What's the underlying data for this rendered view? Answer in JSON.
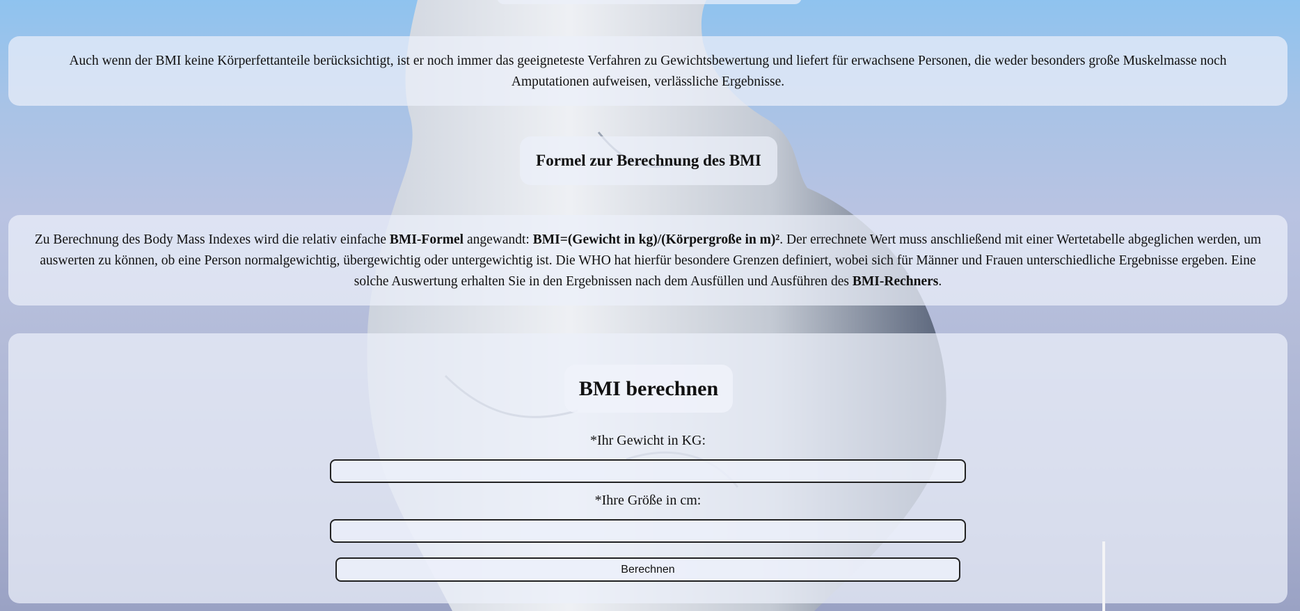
{
  "intro": {
    "text": "Auch wenn der BMI keine Körperfettanteile berücksichtigt, ist er noch immer das geeigneteste Verfahren zu Gewichtsbewertung und liefert für erwachsene Personen, die weder besonders große Muskelmasse noch Amputationen aufweisen, verlässliche Ergebnisse."
  },
  "formula_section": {
    "heading": "Formel zur Berechnung des BMI",
    "text_part1": "Zu Berechnung des Body Mass Indexes wird die relativ einfache ",
    "bold1": "BMI-Formel",
    "text_part2": " angewandt: ",
    "bold2": "BMI=(Gewicht in kg)/(Körpergroße in m)²",
    "text_part3": ". Der errechnete Wert muss anschließend mit einer Wertetabelle abgeglichen werden, um auswerten zu können, ob eine Person normalgewichtig, übergewichtig oder untergewichtig ist. Die WHO hat hierfür besondere Grenzen definiert, wobei sich für Männer und Frauen unterschiedliche Ergebnisse ergeben. Eine solche Auswertung erhalten Sie in den Ergebnissen nach dem Ausfüllen und Ausführen des ",
    "bold3": "BMI-Rechners",
    "text_part4": "."
  },
  "calculator": {
    "title": "BMI berechnen",
    "weight_label": "*Ihr Gewicht in KG:",
    "weight_value": "",
    "height_label": "*Ihre Größe in cm:",
    "height_value": "",
    "button_label": "Berechnen"
  }
}
